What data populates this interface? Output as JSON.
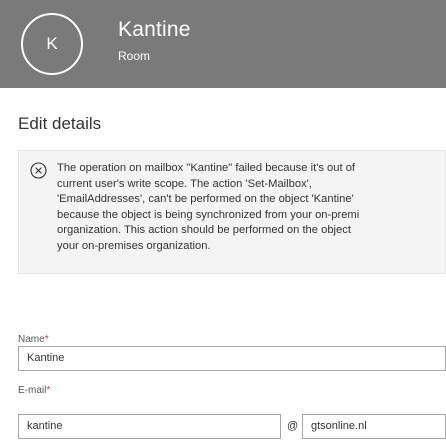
{
  "header": {
    "avatar_initial": "K",
    "name": "Kantine",
    "type": "Room"
  },
  "page": {
    "title": "Edit details"
  },
  "alert": {
    "icon": "close-circle-icon",
    "message": "The operation on mailbox \"Kantine\" failed because it's out of\ncurrent user's write scope. The action 'Set-Mailbox',\n'EmailAddresses', can't be performed on the object 'Kantine'\nbecause the object is being synchronized from your on-premi\norganization. This action should be performed on the object\nyour on-premises organization."
  },
  "form": {
    "name_label": "Name",
    "name_value": "Kantine",
    "email_label": "E-mail",
    "required_marker": "*",
    "email_alias": "kantine",
    "at_sign": "@",
    "email_domain": "gtsonline.nl"
  },
  "colors": {
    "header_bg": "#7a7a7a",
    "alert_bg": "#f4f4f4",
    "required": "#c0392b"
  }
}
